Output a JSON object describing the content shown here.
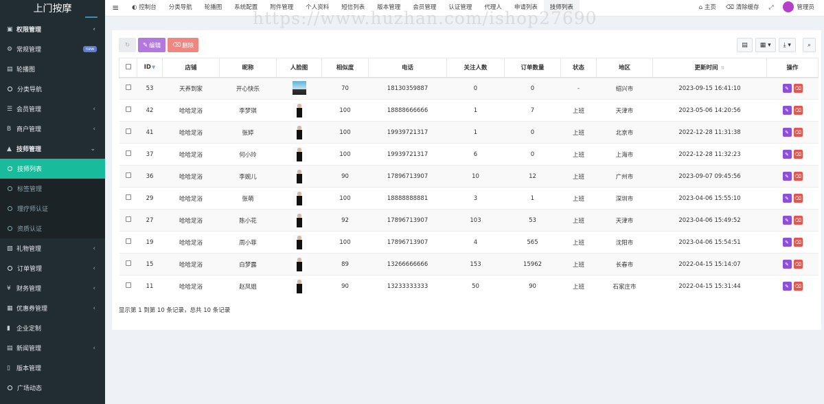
{
  "app": {
    "title": "上门按摩"
  },
  "sidebar": {
    "items": [
      {
        "label": "权限管理",
        "icon": "group-icon",
        "glyph": "▣",
        "arrow": true,
        "bold": true
      },
      {
        "label": "常规管理",
        "icon": "cogs-icon",
        "glyph": "⚙",
        "badge": "new"
      },
      {
        "label": "轮播图",
        "icon": "image-icon",
        "glyph": "▤"
      },
      {
        "label": "分类导航",
        "icon": "circle-icon",
        "ring": true
      },
      {
        "label": "会员管理",
        "icon": "list-icon",
        "glyph": "☰",
        "arrow": true
      },
      {
        "label": "商户管理",
        "icon": "bold-b-icon",
        "glyph": "B",
        "arrow": true
      },
      {
        "label": "技师管理",
        "icon": "user-icon",
        "glyph": "▲",
        "open": true,
        "bold": true
      },
      {
        "label": "技师列表",
        "icon": "circle-icon",
        "ring": true,
        "active": true,
        "sub": true
      },
      {
        "label": "标签管理",
        "icon": "circle-icon",
        "ring": true,
        "sub": true
      },
      {
        "label": "理疗师认证",
        "icon": "circle-icon",
        "ring": true,
        "sub": true
      },
      {
        "label": "资质认证",
        "icon": "circle-icon",
        "ring": true,
        "sub": true
      },
      {
        "label": "礼物管理",
        "icon": "gift-icon",
        "glyph": "▧",
        "arrow": true
      },
      {
        "label": "订单管理",
        "icon": "circle-icon",
        "ring": true,
        "arrow": true
      },
      {
        "label": "财务管理",
        "icon": "yen-icon",
        "glyph": "¥",
        "arrow": true
      },
      {
        "label": "优惠券管理",
        "icon": "ticket-icon",
        "glyph": "▦",
        "arrow": true
      },
      {
        "label": "企业定制",
        "icon": "book-icon",
        "glyph": "▮"
      },
      {
        "label": "新闻管理",
        "icon": "news-icon",
        "glyph": "▤",
        "arrow": true
      },
      {
        "label": "版本管理",
        "icon": "file-icon",
        "glyph": "▯"
      },
      {
        "label": "广场动态",
        "icon": "circle-icon",
        "ring": true
      }
    ]
  },
  "topbar": {
    "menu_toggle": "≡",
    "tabs": [
      {
        "label": "控制台",
        "icon": "dashboard-icon",
        "glyph": "◐ "
      },
      {
        "label": "分类导航"
      },
      {
        "label": "轮播图"
      },
      {
        "label": "系统配置"
      },
      {
        "label": "附件管理"
      },
      {
        "label": "个人资料"
      },
      {
        "label": "短信列表"
      },
      {
        "label": "版本管理"
      },
      {
        "label": "会员管理"
      },
      {
        "label": "认证管理"
      },
      {
        "label": "代理人"
      },
      {
        "label": "申请列表"
      },
      {
        "label": "技师列表",
        "active": true
      }
    ],
    "home_label": "主页",
    "clear_cache_label": "清除缓存",
    "fullscreen": "⤢",
    "admin_label": "管理员"
  },
  "watermark": "https://www.huzhan.com/ishop27690",
  "toolbar": {
    "refresh": "↻",
    "edit_label": "编辑",
    "delete_label": "删除",
    "right": [
      {
        "name": "common-search-button",
        "glyph": "▤"
      },
      {
        "name": "columns-button",
        "glyph": "▦ ▾"
      },
      {
        "name": "export-button",
        "glyph": "⤓ ▾"
      },
      {
        "name": "search-button",
        "glyph": "⌕"
      }
    ]
  },
  "table": {
    "headers": [
      "",
      "ID",
      "店铺",
      "昵称",
      "人脸图",
      "相似度",
      "电话",
      "关注人数",
      "订单数量",
      "状态",
      "地区",
      "更新时间",
      "操作"
    ],
    "rows": [
      {
        "id": "53",
        "shop": "天养到家",
        "nick": "开心快乐",
        "face": "photo",
        "sim": "70",
        "phone": "18130359887",
        "follow": "0",
        "orders": "0",
        "status": "-",
        "region": "绍兴市",
        "time": "2023-09-15 16:41:10"
      },
      {
        "id": "42",
        "shop": "哈哈足浴",
        "nick": "李梦琪",
        "face": "figure",
        "sim": "100",
        "phone": "18888666666",
        "follow": "1",
        "orders": "7",
        "status": "上班",
        "region": "天津市",
        "time": "2023-05-06 14:20:56"
      },
      {
        "id": "41",
        "shop": "哈哈足浴",
        "nick": "张婷",
        "face": "figure",
        "sim": "100",
        "phone": "19939721317",
        "follow": "1",
        "orders": "0",
        "status": "上班",
        "region": "北京市",
        "time": "2022-12-28 11:31:38"
      },
      {
        "id": "37",
        "shop": "哈哈足浴",
        "nick": "何小玲",
        "face": "figure",
        "sim": "100",
        "phone": "19939721317",
        "follow": "6",
        "orders": "0",
        "status": "上班",
        "region": "上海市",
        "time": "2022-12-28 11:32:23"
      },
      {
        "id": "36",
        "shop": "哈哈足浴",
        "nick": "李婉儿",
        "face": "figure",
        "sim": "90",
        "phone": "17896713907",
        "follow": "10",
        "orders": "12",
        "status": "上班",
        "region": "广州市",
        "time": "2023-09-07 09:45:56"
      },
      {
        "id": "29",
        "shop": "哈哈足浴",
        "nick": "张萌",
        "face": "figure",
        "sim": "100",
        "phone": "18888888881",
        "follow": "3",
        "orders": "1",
        "status": "上班",
        "region": "深圳市",
        "time": "2023-04-06 15:55:10"
      },
      {
        "id": "27",
        "shop": "哈哈足浴",
        "nick": "陈小花",
        "face": "figure",
        "sim": "92",
        "phone": "17896713907",
        "follow": "103",
        "orders": "53",
        "status": "上班",
        "region": "天津市",
        "time": "2023-04-06 15:49:52"
      },
      {
        "id": "19",
        "shop": "哈哈足浴",
        "nick": "周小菲",
        "face": "figure",
        "sim": "100",
        "phone": "17896713907",
        "follow": "4",
        "orders": "565",
        "status": "上班",
        "region": "沈阳市",
        "time": "2023-04-06 15:54:51"
      },
      {
        "id": "15",
        "shop": "哈哈足浴",
        "nick": "白梦露",
        "face": "figure",
        "sim": "89",
        "phone": "13266666666",
        "follow": "153",
        "orders": "15962",
        "status": "上班",
        "region": "长春市",
        "time": "2022-04-15 15:14:07"
      },
      {
        "id": "11",
        "shop": "哈哈足浴",
        "nick": "赵凤姐",
        "face": "figure",
        "sim": "90",
        "phone": "13233333333",
        "follow": "50",
        "orders": "90",
        "status": "上班",
        "region": "石家庄市",
        "time": "2022-04-15 15:31:44"
      }
    ]
  },
  "pagination": {
    "summary": "显示第 1 到第 10 条记录，总共 10 条记录"
  },
  "colors": {
    "sidebar_bg": "#222d32",
    "active_green": "#18bc9c",
    "edit_purple": "#8b4fd9",
    "delete_red": "#e7534d"
  }
}
